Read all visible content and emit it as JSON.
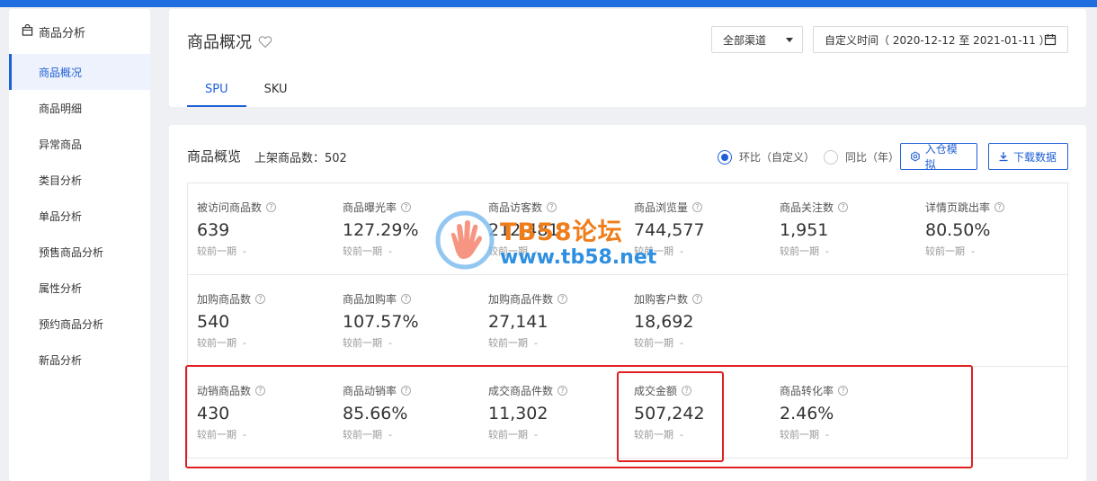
{
  "sidebar": {
    "header": "商品分析",
    "items": [
      {
        "label": "商品概况",
        "active": true
      },
      {
        "label": "商品明细"
      },
      {
        "label": "异常商品"
      },
      {
        "label": "类目分析"
      },
      {
        "label": "单品分析"
      },
      {
        "label": "预售商品分析"
      },
      {
        "label": "属性分析"
      },
      {
        "label": "预约商品分析"
      },
      {
        "label": "新品分析"
      }
    ]
  },
  "header": {
    "title": "商品概况",
    "channel": "全部渠道",
    "date_range": "自定义时间（ 2020-12-12 至 2021-01-11 ）",
    "tabs": [
      "SPU",
      "SKU"
    ]
  },
  "overview": {
    "title": "商品概览",
    "subtitle": "上架商品数：502",
    "radio_options": [
      "环比（自定义）",
      "同比（年）"
    ],
    "selected_radio": 0,
    "simulate_button": "入仓模拟",
    "download_button": "下载数据",
    "rows": [
      [
        {
          "label": "被访问商品数",
          "value": "639",
          "compare": "较前一期",
          "delta": "-"
        },
        {
          "label": "商品曝光率",
          "value": "127.29%",
          "compare": "较前一期",
          "delta": "-"
        },
        {
          "label": "商品访客数",
          "value": "212,481",
          "compare": "较前一期",
          "delta": "-"
        },
        {
          "label": "商品浏览量",
          "value": "744,577",
          "compare": "较前一期",
          "delta": "-"
        },
        {
          "label": "商品关注数",
          "value": "1,951",
          "compare": "较前一期",
          "delta": "-"
        },
        {
          "label": "详情页跳出率",
          "value": "80.50%",
          "compare": "较前一期",
          "delta": "-"
        }
      ],
      [
        {
          "label": "加购商品数",
          "value": "540",
          "compare": "较前一期",
          "delta": "-"
        },
        {
          "label": "商品加购率",
          "value": "107.57%",
          "compare": "较前一期",
          "delta": "-"
        },
        {
          "label": "加购商品件数",
          "value": "27,141",
          "compare": "较前一期",
          "delta": "-"
        },
        {
          "label": "加购客户数",
          "value": "18,692",
          "compare": "较前一期",
          "delta": "-"
        }
      ],
      [
        {
          "label": "动销商品数",
          "value": "430",
          "compare": "较前一期",
          "delta": "-"
        },
        {
          "label": "商品动销率",
          "value": "85.66%",
          "compare": "较前一期",
          "delta": "-"
        },
        {
          "label": "成交商品件数",
          "value": "11,302",
          "compare": "较前一期",
          "delta": "-"
        },
        {
          "label": "成交金额",
          "value": "507,242",
          "compare": "较前一期",
          "delta": "-"
        },
        {
          "label": "商品转化率",
          "value": "2.46%",
          "compare": "较前一期",
          "delta": "-"
        }
      ]
    ]
  },
  "watermark": {
    "title": "TB58论坛",
    "url": "www.tb58.net"
  },
  "colors": {
    "accent": "#1f5fd6",
    "highlight": "#e02020",
    "watermark_orange": "#ef7d1a",
    "watermark_blue": "#2f8fe0"
  }
}
